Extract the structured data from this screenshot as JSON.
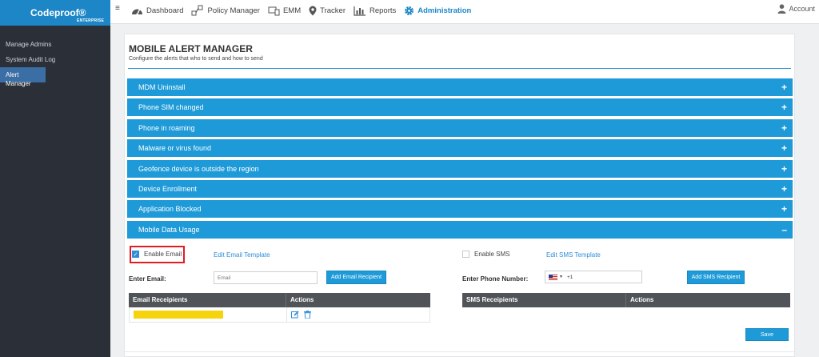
{
  "app": {
    "name": "Codeproof®",
    "edition": "ENTERPRISE"
  },
  "sidebar": {
    "items": [
      {
        "label": "Manage Admins"
      },
      {
        "label": "System Audit Log"
      },
      {
        "label": "Alert Manager",
        "active": true
      }
    ]
  },
  "topnav": {
    "items": [
      {
        "label": "Dashboard",
        "icon": "dashboard-icon"
      },
      {
        "label": "Policy Manager",
        "icon": "policy-icon"
      },
      {
        "label": "EMM",
        "icon": "emm-icon"
      },
      {
        "label": "Tracker",
        "icon": "location-pin-icon"
      },
      {
        "label": "Reports",
        "icon": "reports-icon"
      },
      {
        "label": "Administration",
        "icon": "gear-icon",
        "active": true
      }
    ],
    "account_label": "Account"
  },
  "page": {
    "title": "MOBILE ALERT MANAGER",
    "subtitle": "Configure the alerts that who to send and how to send"
  },
  "alerts": [
    {
      "label": "MDM Uninstall",
      "expanded": false
    },
    {
      "label": "Phone SIM changed",
      "expanded": false
    },
    {
      "label": "Phone in roaming",
      "expanded": false
    },
    {
      "label": "Malware or virus found",
      "expanded": false
    },
    {
      "label": "Geofence device is outside the region",
      "expanded": false
    },
    {
      "label": "Device Enrollment",
      "expanded": false
    },
    {
      "label": "Application Blocked",
      "expanded": false
    },
    {
      "label": "Mobile Data Usage",
      "expanded": true
    }
  ],
  "signs": {
    "collapsed": "+",
    "expanded": "–"
  },
  "detail": {
    "email": {
      "enable_label": "Enable Email",
      "checked": true,
      "edit_template": "Edit Email Template",
      "enter_label": "Enter Email:",
      "placeholder": "Email",
      "add_button": "Add Email Recipient",
      "table_headers": [
        "Email Receipients",
        "Actions"
      ]
    },
    "sms": {
      "enable_label": "Enable SMS",
      "checked": false,
      "edit_template": "Edit SMS Template",
      "enter_label": "Enter Phone Number:",
      "dial_code": "+1",
      "add_button": "Add SMS Recipient",
      "table_headers": [
        "SMS Receipients",
        "Actions"
      ]
    },
    "save_label": "Save",
    "check_glyph": "✓"
  },
  "colors": {
    "accent": "#1e9ad8",
    "brand": "#1c86c6",
    "sidebar": "#2a2f38",
    "highlight": "#e31b23"
  }
}
